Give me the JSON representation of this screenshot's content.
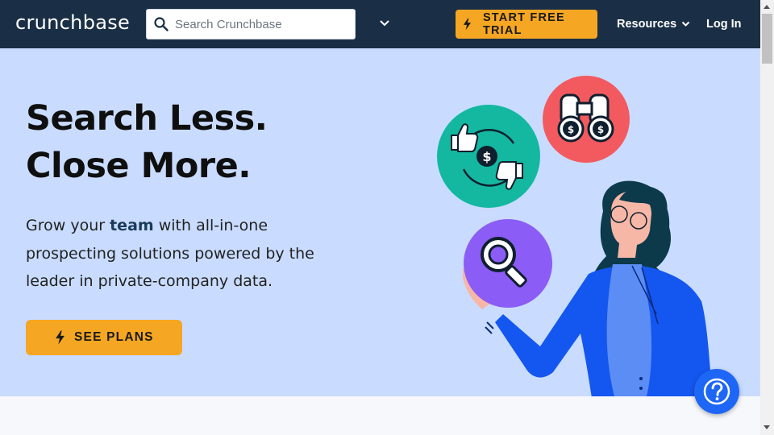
{
  "header": {
    "logo_text": "crunchbase",
    "search": {
      "placeholder": "Search Crunchbase",
      "value": ""
    },
    "trial_label": "START FREE TRIAL",
    "resources_label": "Resources",
    "login_label": "Log In"
  },
  "hero": {
    "headline_line1": "Search Less.",
    "headline_line2": "Close More.",
    "sub_pre": "Grow your ",
    "sub_emph": "team",
    "sub_post": " with all-in-one prospecting solutions powered by the leader in private-company data.",
    "cta_label": "SEE PLANS"
  },
  "icons": [
    "search-icon",
    "chevron-down-icon",
    "lightning-bolt-icon",
    "question-mark-icon",
    "thumbs-up-icon",
    "thumbs-down-icon",
    "dollar-icon",
    "binoculars-icon",
    "magnifying-glass-icon"
  ],
  "colors": {
    "nav_bg": "#1a2f45",
    "hero_bg": "#c9dcff",
    "accent_orange": "#f5a623",
    "help_blue": "#1e66f5",
    "teal_circle": "#14b8a0",
    "red_circle": "#f25a5f",
    "purple_circle": "#8b5cf6",
    "jacket_blue": "#1456f0"
  }
}
